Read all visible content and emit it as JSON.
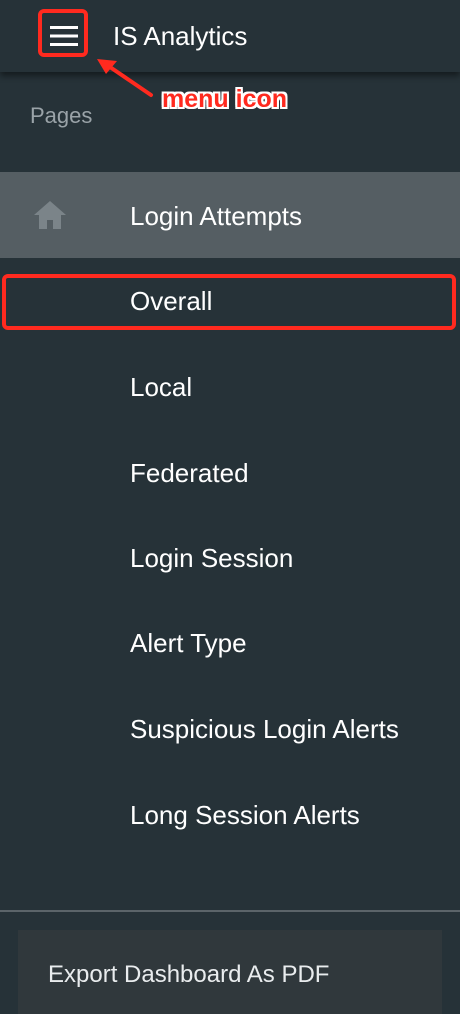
{
  "header": {
    "app_title": "IS Analytics",
    "menu_icon": "hamburger-menu-icon"
  },
  "annotation": {
    "label": "menu icon",
    "color": "#ff2a1f"
  },
  "sidebar": {
    "section_label": "Pages",
    "parent": {
      "label": "Login Attempts",
      "icon": "home-icon",
      "active": true
    },
    "items": [
      {
        "label": "Overall",
        "highlighted": true
      },
      {
        "label": "Local"
      },
      {
        "label": "Federated"
      },
      {
        "label": "Login Session"
      },
      {
        "label": "Alert Type"
      },
      {
        "label": "Suspicious Login Alerts"
      },
      {
        "label": "Long Session Alerts"
      }
    ],
    "export_button": {
      "label": "Export Dashboard As PDF"
    }
  },
  "colors": {
    "background": "#263238",
    "active_item_bg": "#555e63",
    "highlight_border": "#ff2a1f"
  }
}
